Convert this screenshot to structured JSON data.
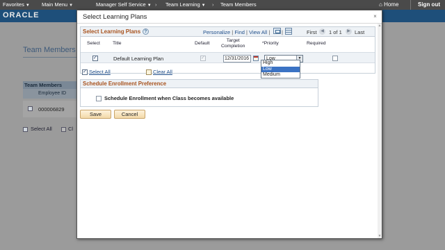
{
  "topnav": {
    "favorites": "Favorites",
    "main_menu": "Main Menu",
    "crumb1": "Manager Self Service",
    "crumb2": "Team Learning",
    "crumb3": "Team Members",
    "home": "Home",
    "sign_out": "Sign out"
  },
  "brand": {
    "logo": "ORACLE"
  },
  "background_page": {
    "title": "Team Members",
    "team_header": "Team Members",
    "employee_id_header": "Employee ID",
    "employee_id": "000006829",
    "select_all": "Select All",
    "clear_all_partial": "Cl"
  },
  "modal": {
    "title": "Select Learning Plans",
    "close": "×",
    "grid": {
      "title": "Select Learning Plans",
      "personalize": "Personalize",
      "find": "Find",
      "view_all": "View All",
      "first": "First",
      "count": "1 of 1",
      "last": "Last",
      "columns": {
        "select": "Select",
        "title": "Title",
        "default": "Default",
        "target_completion_1": "Target",
        "target_completion_2": "Completion",
        "priority": "*Priority",
        "required": "Required"
      },
      "row": {
        "title": "Default Learning Plan",
        "target_date": "12/31/2016",
        "priority": "Low"
      },
      "priority_options": [
        "High",
        "Low",
        "Medium"
      ]
    },
    "select_all": "Select All",
    "clear_all": "Clear All",
    "pref": {
      "header": "Schedule Enrollment Preference",
      "option": "Schedule Enrollment when Class becomes available"
    },
    "buttons": {
      "save": "Save",
      "cancel": "Cancel"
    }
  }
}
